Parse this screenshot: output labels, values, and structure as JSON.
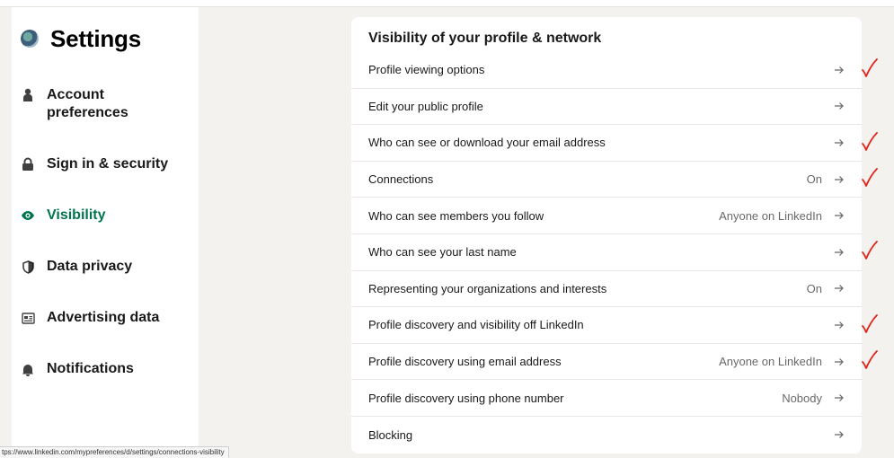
{
  "sidebar": {
    "title": "Settings",
    "items": [
      {
        "label": "Account preferences",
        "icon": "person-icon",
        "active": false
      },
      {
        "label": "Sign in & security",
        "icon": "lock-icon",
        "active": false
      },
      {
        "label": "Visibility",
        "icon": "eye-icon",
        "active": true
      },
      {
        "label": "Data privacy",
        "icon": "shield-icon",
        "active": false
      },
      {
        "label": "Advertising data",
        "icon": "newspaper-icon",
        "active": false
      },
      {
        "label": "Notifications",
        "icon": "bell-icon",
        "active": false
      }
    ]
  },
  "main": {
    "section_title": "Visibility of your profile & network",
    "rows": [
      {
        "label": "Profile viewing options",
        "value": "",
        "checked": true
      },
      {
        "label": "Edit your public profile",
        "value": "",
        "checked": false
      },
      {
        "label": "Who can see or download your email address",
        "value": "",
        "checked": true
      },
      {
        "label": "Connections",
        "value": "On",
        "checked": true
      },
      {
        "label": "Who can see members you follow",
        "value": "Anyone on LinkedIn",
        "checked": false
      },
      {
        "label": "Who can see your last name",
        "value": "",
        "checked": true
      },
      {
        "label": "Representing your organizations and interests",
        "value": "On",
        "checked": false
      },
      {
        "label": "Profile discovery and visibility off LinkedIn",
        "value": "",
        "checked": true
      },
      {
        "label": "Profile discovery using email address",
        "value": "Anyone on LinkedIn",
        "checked": true
      },
      {
        "label": "Profile discovery using phone number",
        "value": "Nobody",
        "checked": false
      },
      {
        "label": "Blocking",
        "value": "",
        "checked": false
      }
    ]
  },
  "status_bar": {
    "url": "tps://www.linkedin.com/mypreferences/d/settings/connections-visibility"
  },
  "colors": {
    "active_green": "#01754f",
    "background": "#f4f2ee",
    "check_mark": "#e0241b"
  }
}
